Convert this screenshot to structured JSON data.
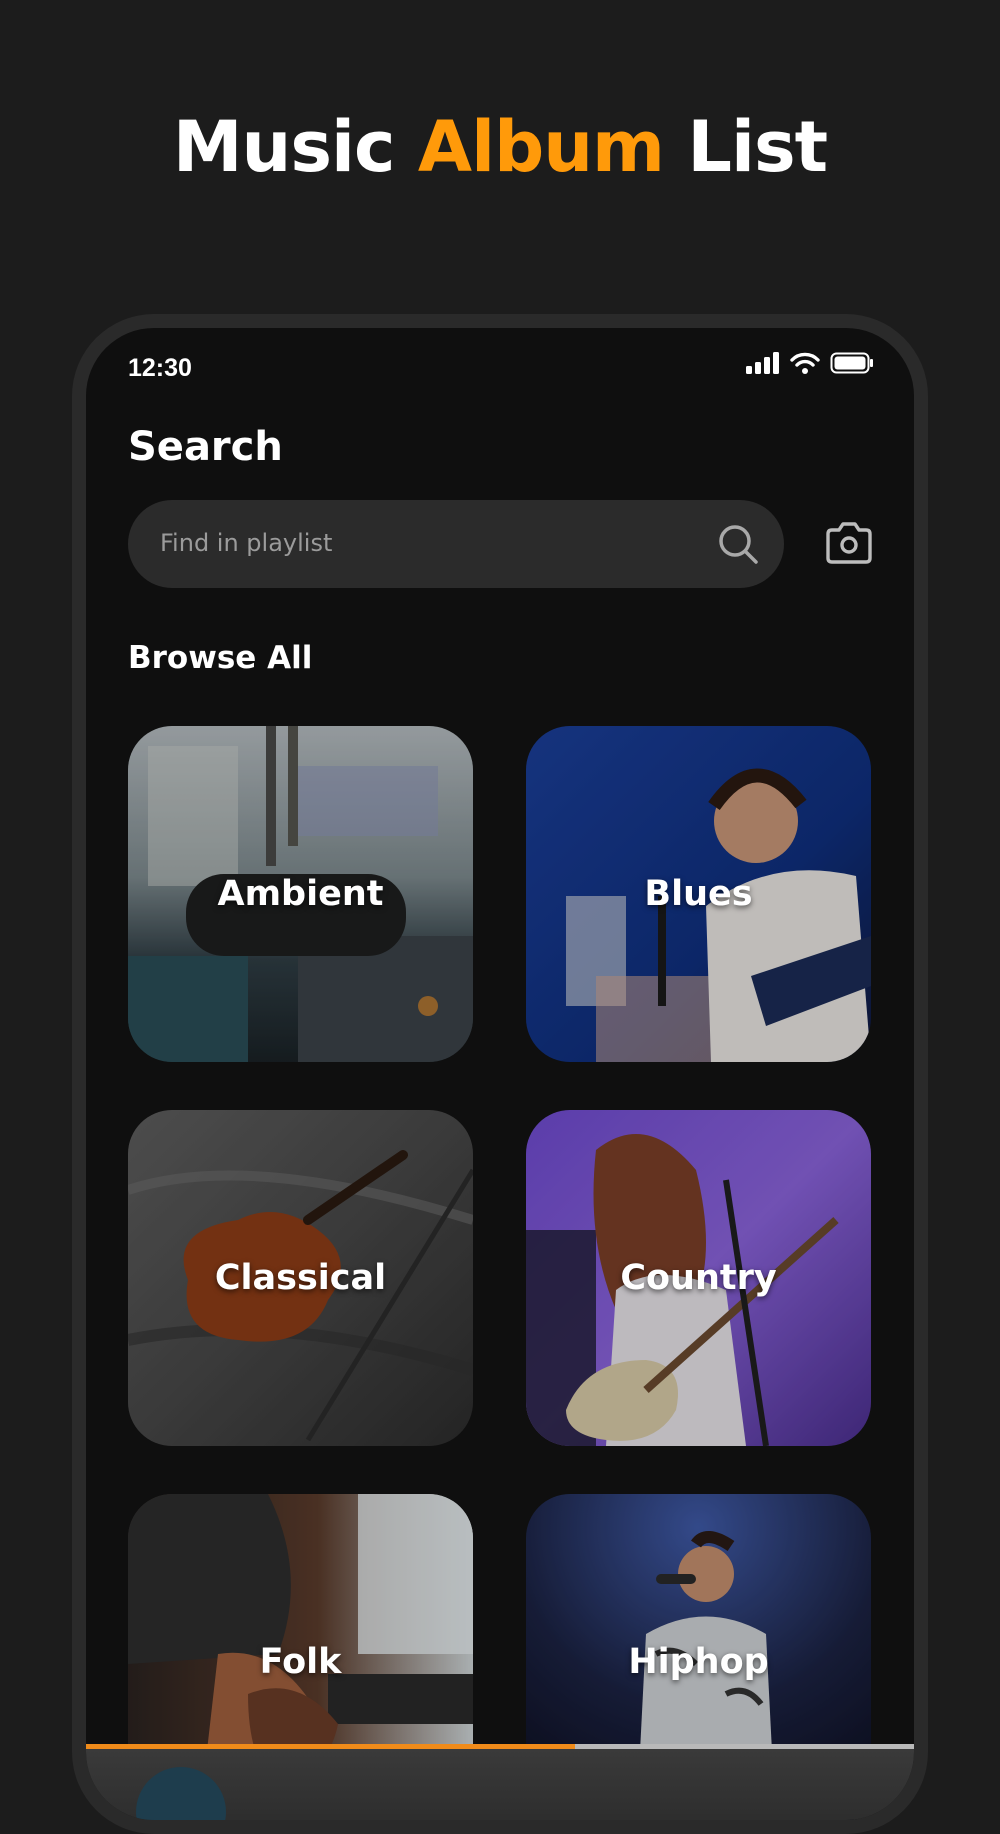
{
  "promo": {
    "title_word1": "Music",
    "title_word2": "Album",
    "title_word3": "List",
    "accent_color": "#ff9a0a"
  },
  "status_bar": {
    "time": "12:30",
    "icons": [
      "cellular-signal-icon",
      "wifi-icon",
      "battery-icon"
    ]
  },
  "search": {
    "heading": "Search",
    "placeholder": "Find in playlist",
    "search_icon": "search-icon",
    "camera_icon": "camera-icon"
  },
  "browse": {
    "heading": "Browse All",
    "genres": [
      {
        "label": "Ambient",
        "image": "microphone-studio-photo"
      },
      {
        "label": "Blues",
        "image": "guitarist-headphones-photo"
      },
      {
        "label": "Classical",
        "image": "violin-on-bed-photo"
      },
      {
        "label": "Country",
        "image": "singer-bass-guitar-photo"
      },
      {
        "label": "Folk",
        "image": "acoustic-guitar-photo"
      },
      {
        "label": "Hiphop",
        "image": "rapper-stage-photo"
      }
    ]
  },
  "player": {
    "progress_fraction": 0.59,
    "progress_color": "#f08b1a"
  }
}
